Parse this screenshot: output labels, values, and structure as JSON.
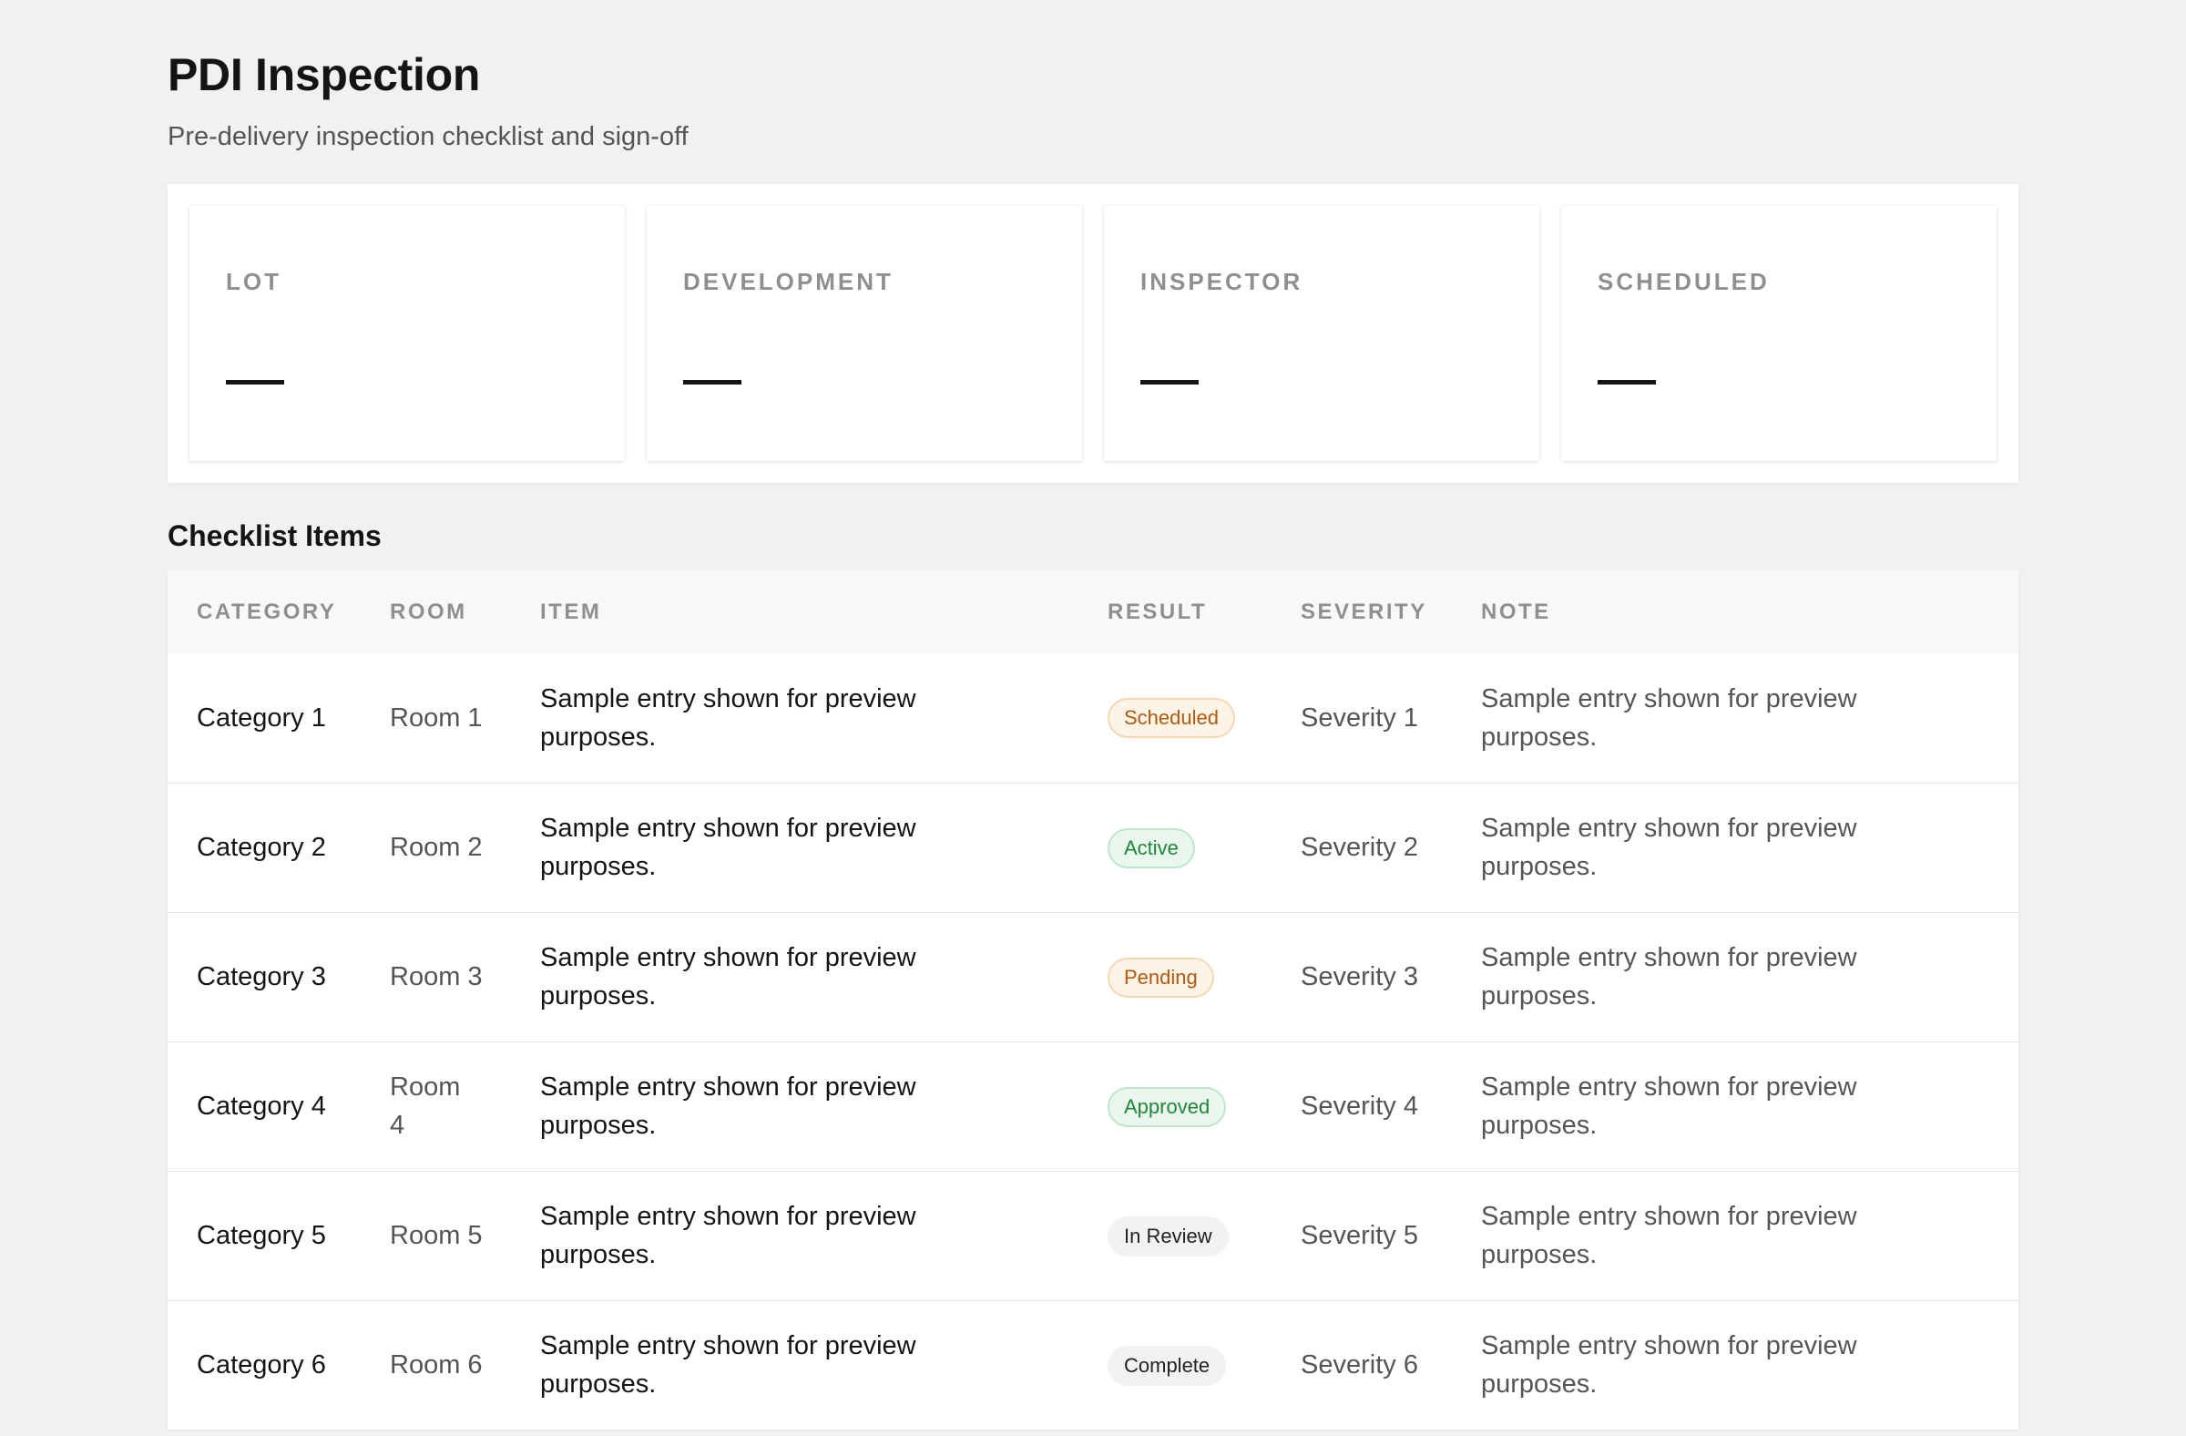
{
  "header": {
    "title": "PDI Inspection",
    "subtitle": "Pre-delivery inspection checklist and sign-off"
  },
  "summary": [
    {
      "label": "LOT",
      "value": "—"
    },
    {
      "label": "DEVELOPMENT",
      "value": "—"
    },
    {
      "label": "INSPECTOR",
      "value": "—"
    },
    {
      "label": "SCHEDULED",
      "value": "—"
    }
  ],
  "checklist": {
    "title": "Checklist Items",
    "columns": [
      "CATEGORY",
      "ROOM",
      "ITEM",
      "RESULT",
      "SEVERITY",
      "NOTE"
    ],
    "rows": [
      {
        "category": "Category 1",
        "room": "Room 1",
        "item": "Sample entry shown for preview purposes.",
        "result": "Scheduled",
        "result_tone": "orange",
        "severity": "Severity 1",
        "note": "Sample entry shown for preview purposes."
      },
      {
        "category": "Category 2",
        "room": "Room 2",
        "item": "Sample entry shown for preview purposes.",
        "result": "Active",
        "result_tone": "green",
        "severity": "Severity 2",
        "note": "Sample entry shown for preview purposes."
      },
      {
        "category": "Category 3",
        "room": "Room 3",
        "item": "Sample entry shown for preview purposes.",
        "result": "Pending",
        "result_tone": "orange",
        "severity": "Severity 3",
        "note": "Sample entry shown for preview purposes."
      },
      {
        "category": "Category 4",
        "room": "Room 4",
        "item": "Sample entry shown for preview purposes.",
        "result": "Approved",
        "result_tone": "green",
        "severity": "Severity 4",
        "note": "Sample entry shown for preview purposes."
      },
      {
        "category": "Category 5",
        "room": "Room 5",
        "item": "Sample entry shown for preview purposes.",
        "result": "In Review",
        "result_tone": "gray",
        "severity": "Severity 5",
        "note": "Sample entry shown for preview purposes."
      },
      {
        "category": "Category 6",
        "room": "Room 6",
        "item": "Sample entry shown for preview purposes.",
        "result": "Complete",
        "result_tone": "gray",
        "severity": "Severity 6",
        "note": "Sample entry shown for preview purposes."
      }
    ]
  }
}
